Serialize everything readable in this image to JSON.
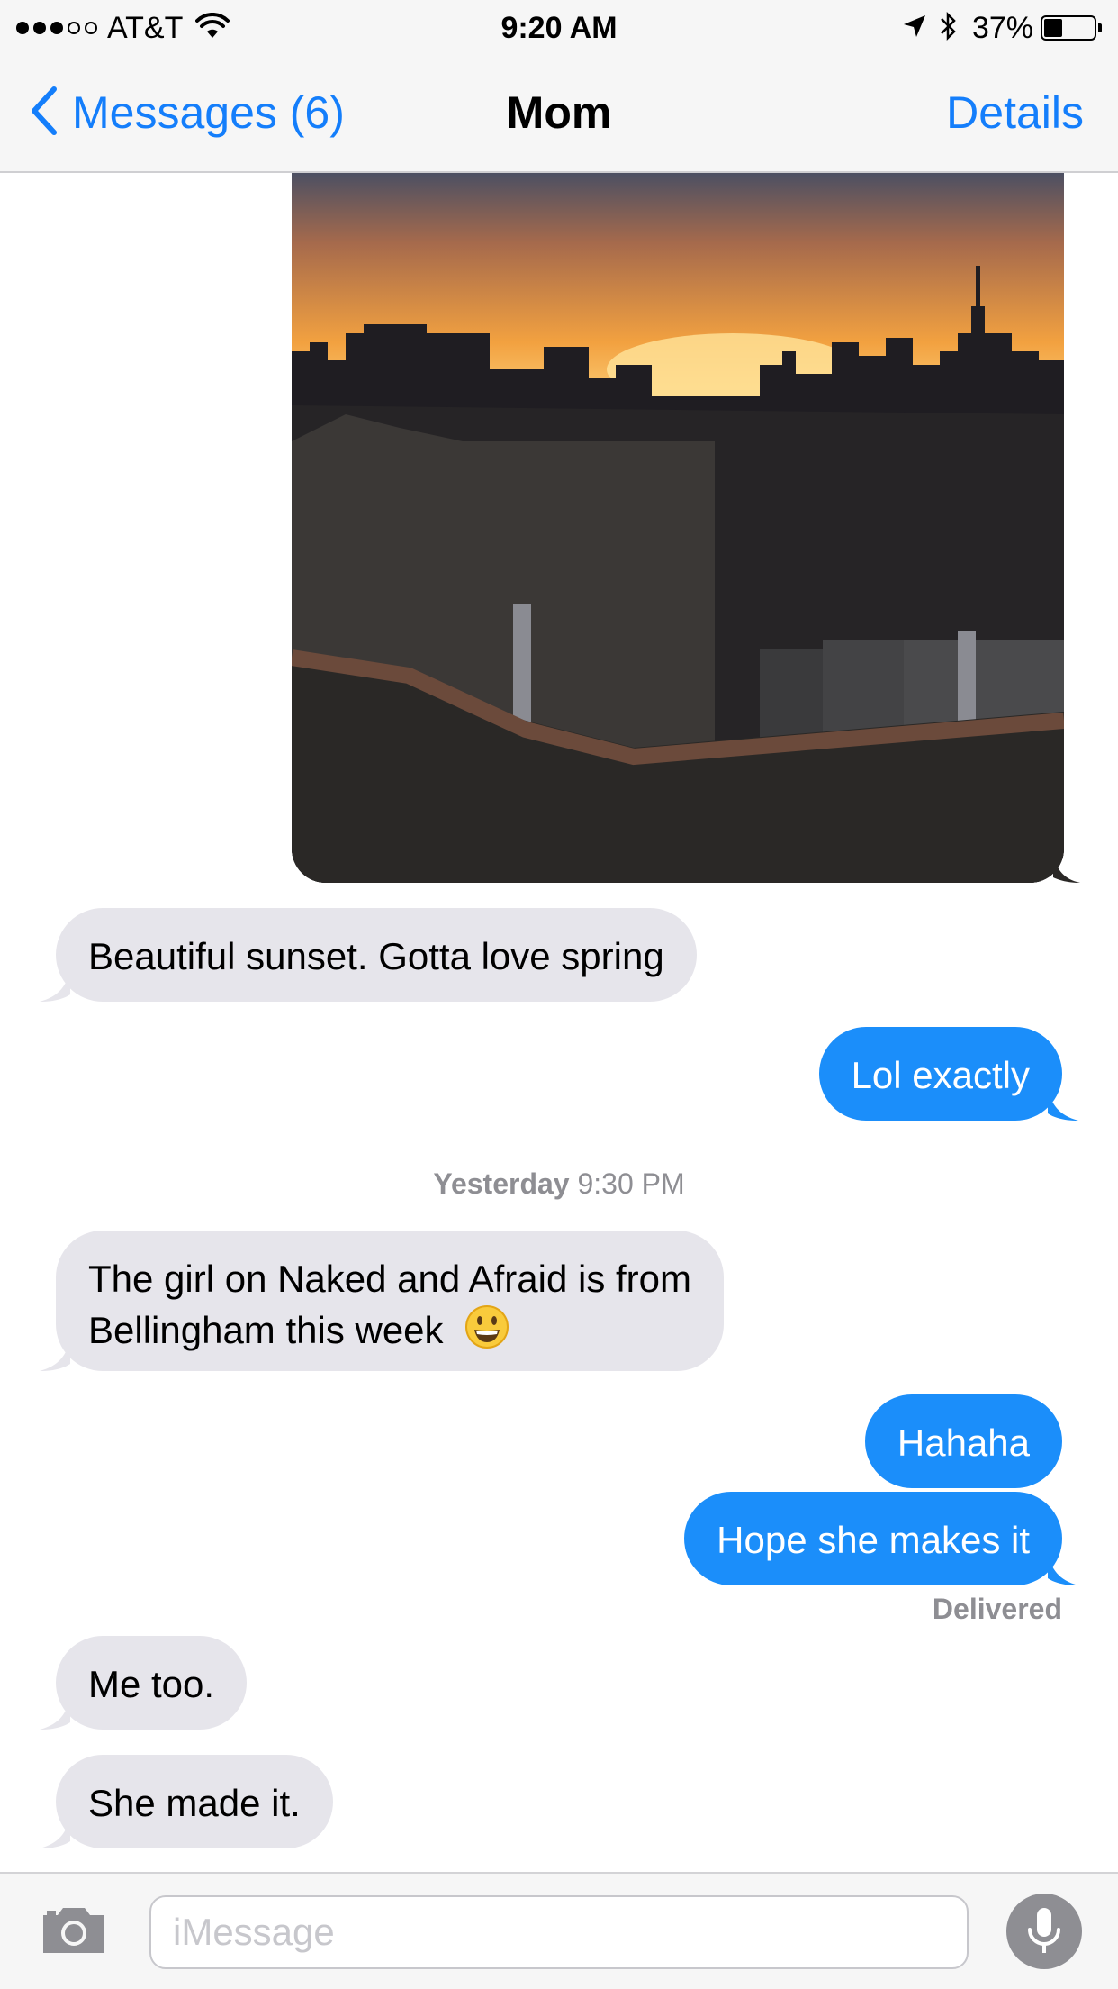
{
  "status_bar": {
    "carrier": "AT&T",
    "signal_bars": 3,
    "signal_total": 5,
    "time": "9:20 AM",
    "battery_percent": "37%",
    "battery_level": 0.37,
    "icons": [
      "wifi-icon",
      "location-arrow-icon",
      "bluetooth-icon",
      "battery-icon"
    ]
  },
  "nav": {
    "back_label": "Messages (6)",
    "title": "Mom",
    "details_label": "Details"
  },
  "messages": [
    {
      "type": "image",
      "direction": "outgoing",
      "description_icon": "photo"
    },
    {
      "direction": "incoming",
      "text": "Beautiful sunset. Gotta love spring"
    },
    {
      "direction": "outgoing",
      "text": "Lol exactly"
    },
    {
      "type": "timestamp",
      "day": "Yesterday",
      "time": "9:30 PM"
    },
    {
      "direction": "incoming",
      "lines": [
        "The girl on Naked and Afraid is from",
        "Bellingham this week"
      ],
      "emoji": "😀"
    },
    {
      "direction": "outgoing",
      "text": "Hahaha"
    },
    {
      "direction": "outgoing",
      "text": "Hope she makes it"
    },
    {
      "type": "status",
      "text": "Delivered"
    },
    {
      "direction": "incoming",
      "text": "Me too."
    },
    {
      "direction": "incoming",
      "text": "She made it."
    }
  ],
  "input": {
    "placeholder": "iMessage"
  },
  "colors": {
    "accent": "#147efb",
    "outgoing_bubble": "#1b8efa",
    "incoming_bubble": "#e6e5eb"
  }
}
